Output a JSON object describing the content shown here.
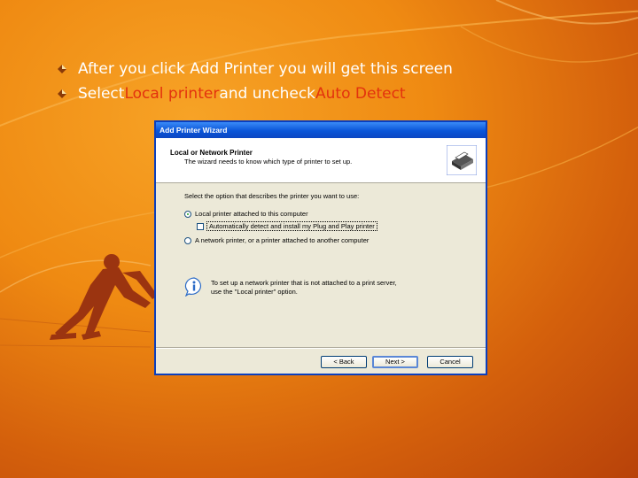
{
  "slide": {
    "bullets": [
      {
        "text": "After you click Add Printer you will get this screen"
      },
      {
        "prefix": "Select ",
        "hl1": "Local printer",
        "mid": " and uncheck ",
        "hl2": "Auto Detect"
      }
    ],
    "colors": {
      "highlight": "#e3320e",
      "text": "#ffffff"
    }
  },
  "wizard": {
    "title": "Add Printer Wizard",
    "header_title": "Local or Network Printer",
    "header_subtitle": "The wizard needs to know which type of printer to set up.",
    "prompt": "Select the option that describes the printer you want to use:",
    "options": {
      "local": "Local printer attached to this computer",
      "autodetect": "Automatically detect and install my Plug and Play printer",
      "network": "A network printer, or a printer attached to another computer"
    },
    "info_text": "To set up a network printer that is not attached to a print server, use the \"Local printer\" option.",
    "buttons": {
      "back": "< Back",
      "next": "Next >",
      "cancel": "Cancel"
    }
  }
}
